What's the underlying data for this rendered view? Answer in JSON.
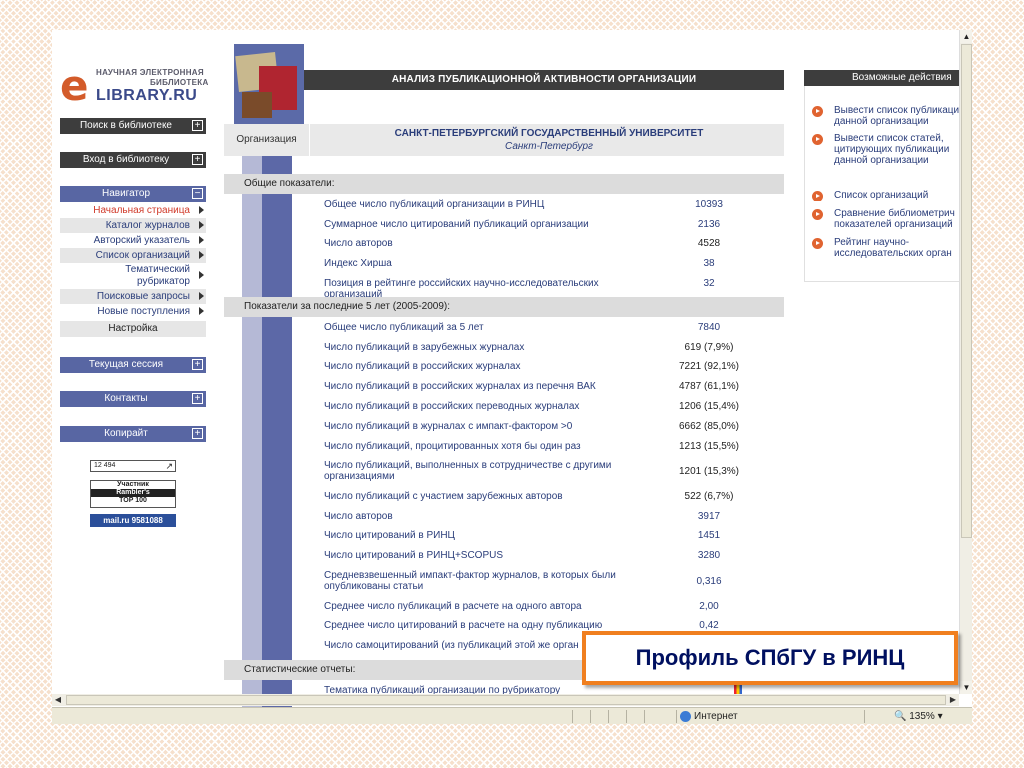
{
  "logo": {
    "line1": "НАУЧНАЯ ЭЛЕКТРОННАЯ",
    "line2": "БИБЛИОТЕКА",
    "brand": "LIBRARY.RU",
    "letter": "e"
  },
  "left": {
    "search_label": "Поиск в библиотеке",
    "login_label": "Вход в библиотеку",
    "navigator_label": "Навигатор",
    "nav_items": [
      "Начальная страница",
      "Каталог журналов",
      "Авторский указатель",
      "Список организаций",
      "Тематический рубрикатор",
      "Поисковые запросы",
      "Новые поступления"
    ],
    "settings_label": "Настройка",
    "session_label": "Текущая сессия",
    "contacts_label": "Контакты",
    "copyright_label": "Копирайт",
    "counter1": "12 494",
    "rambler_line1": "Участник",
    "rambler_line2": "Rambler's",
    "rambler_line3": "TOP 100",
    "mail_counter": "mail.ru 9581088"
  },
  "header": {
    "title": "АНАЛИЗ ПУБЛИКАЦИОННОЙ АКТИВНОСТИ ОРГАНИЗАЦИИ"
  },
  "org": {
    "label": "Организация",
    "name": "САНКТ-ПЕТЕРБУРГСКИЙ ГОСУДАРСТВЕННЫЙ УНИВЕРСИТЕТ",
    "city": "Санкт-Петербург"
  },
  "sections": {
    "general": "Общие показатели:",
    "last5": "Показатели за последние 5 лет (2005-2009):",
    "reports": "Статистические отчеты:"
  },
  "general_rows": [
    {
      "label": "Общее число публикаций организации в РИНЦ",
      "value": "10393"
    },
    {
      "label": "Суммарное число цитирований публикаций организации",
      "value": "2136"
    },
    {
      "label": "Число авторов",
      "value": "4528"
    },
    {
      "label": "Индекс Хирша",
      "value": "38"
    },
    {
      "label": "Позиция в рейтинге российских научно-исследовательских организаций",
      "value": "32"
    }
  ],
  "last5_rows": [
    {
      "label": "Общее число публикаций за 5 лет",
      "value": "7840"
    },
    {
      "label": "Число публикаций в зарубежных журналах",
      "value": "619 (7,9%)"
    },
    {
      "label": "Число публикаций в российских журналах",
      "value": "7221 (92,1%)"
    },
    {
      "label": "Число публикаций в российских журналах из перечня ВАК",
      "value": "4787 (61,1%)"
    },
    {
      "label": "Число публикаций в российских переводных журналах",
      "value": "1206 (15,4%)"
    },
    {
      "label": "Число публикаций в журналах с импакт-фактором >0",
      "value": "6662 (85,0%)"
    },
    {
      "label": "Число публикаций, процитированных хотя бы один раз",
      "value": "1213 (15,5%)"
    },
    {
      "label": "Число публикаций, выполненных в сотрудничестве с другими организациями",
      "value": "1201 (15,3%)"
    },
    {
      "label": "Число публикаций с участием зарубежных авторов",
      "value": "522 (6,7%)"
    },
    {
      "label": "Число авторов",
      "value": "3917"
    },
    {
      "label": "Число цитирований в РИНЦ",
      "value": "1451"
    },
    {
      "label": "Число цитирований в РИНЦ+SCOPUS",
      "value": "3280"
    },
    {
      "label": "Средневзвешенный импакт-фактор журналов, в которых были опубликованы статьи",
      "value": "0,316"
    },
    {
      "label": "Среднее число публикаций в расчете на одного автора",
      "value": "2,00"
    },
    {
      "label": "Среднее число цитирований в расчете на одну публикацию",
      "value": "0,42"
    },
    {
      "label": "Число самоцитирований (из публикаций этой же орган",
      "value": ""
    }
  ],
  "report_rows": [
    {
      "label": "Тематика публикаций организации по рубрикатору"
    }
  ],
  "actions": {
    "title": "Возможные действия",
    "items": [
      "Вывести список публикаций данной организации",
      "Вывести список статей, цитирующих публикации данной организации",
      "Список организаций",
      "Сравнение библиометрических показателей организаций",
      "Рейтинг научно-исследовательских организаций"
    ],
    "items_visible": [
      [
        "Вывести список публикаци",
        "данной организации"
      ],
      [
        "Вывести список статей,",
        "цитирующих публикации",
        "данной организации"
      ],
      [
        "Список организаций"
      ],
      [
        "Сравнение библиометрич",
        "показателей организаций"
      ],
      [
        "Рейтинг научно-",
        "исследовательских орган"
      ]
    ]
  },
  "status": {
    "zone": "Интернет",
    "zoom": "135%"
  },
  "callout": {
    "text": "Профиль СПбГУ в РИНЦ"
  },
  "colors": {
    "accent_orange": "#f07f1f",
    "nav_blue": "#5866a3",
    "dark_bar": "#3d3d3d",
    "link_blue": "#2a3d7a",
    "logo_orange": "#d35b2a"
  }
}
